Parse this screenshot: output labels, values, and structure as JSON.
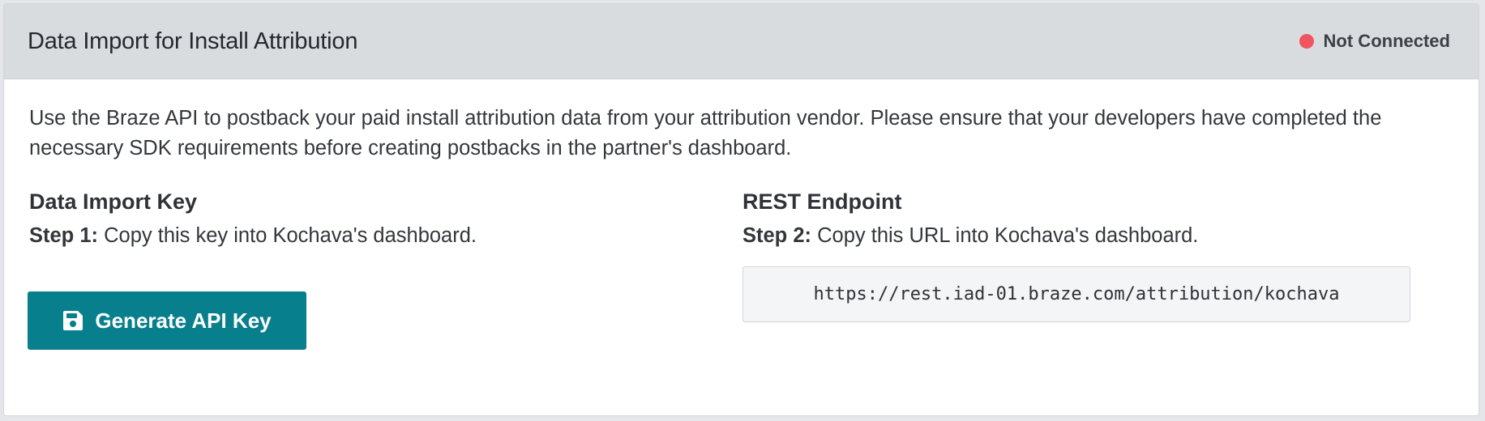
{
  "header": {
    "title": "Data Import for Install Attribution",
    "status_label": "Not Connected",
    "status_color": "#f0545f"
  },
  "description": "Use the Braze API to postback your paid install attribution data from your attribution vendor. Please ensure that your developers have completed the necessary SDK requirements before creating postbacks in the partner's dashboard.",
  "data_import_key": {
    "title": "Data Import Key",
    "step_label": "Step 1:",
    "step_text": " Copy this key into Kochava's dashboard.",
    "button_label": "Generate API Key",
    "button_icon": "save-icon",
    "button_color": "#087f8c"
  },
  "rest_endpoint": {
    "title": "REST Endpoint",
    "step_label": "Step 2:",
    "step_text": " Copy this URL into Kochava's dashboard.",
    "url": "https://rest.iad-01.braze.com/attribution/kochava"
  }
}
